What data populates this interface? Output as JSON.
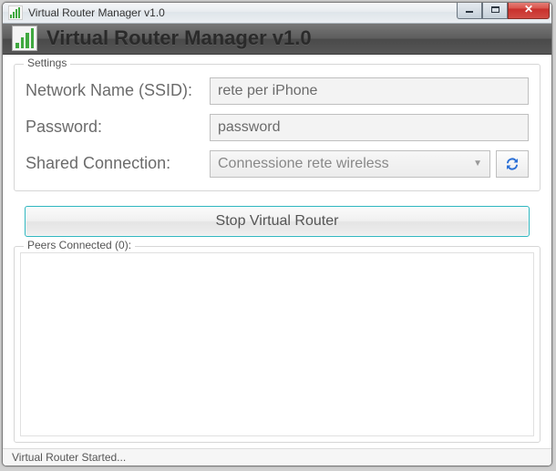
{
  "window": {
    "title": "Virtual Router Manager v1.0"
  },
  "header": {
    "title": "Virtual Router Manager v1.0"
  },
  "settings": {
    "legend": "Settings",
    "ssid_label": "Network Name (SSID):",
    "ssid_value": "rete per iPhone",
    "password_label": "Password:",
    "password_value": "password",
    "shared_label": "Shared Connection:",
    "shared_value": "Connessione rete wireless"
  },
  "main_button": {
    "label": "Stop Virtual Router"
  },
  "peers": {
    "legend_prefix": "Peers Connected",
    "count": 0
  },
  "status": {
    "text": "Virtual Router Started..."
  }
}
